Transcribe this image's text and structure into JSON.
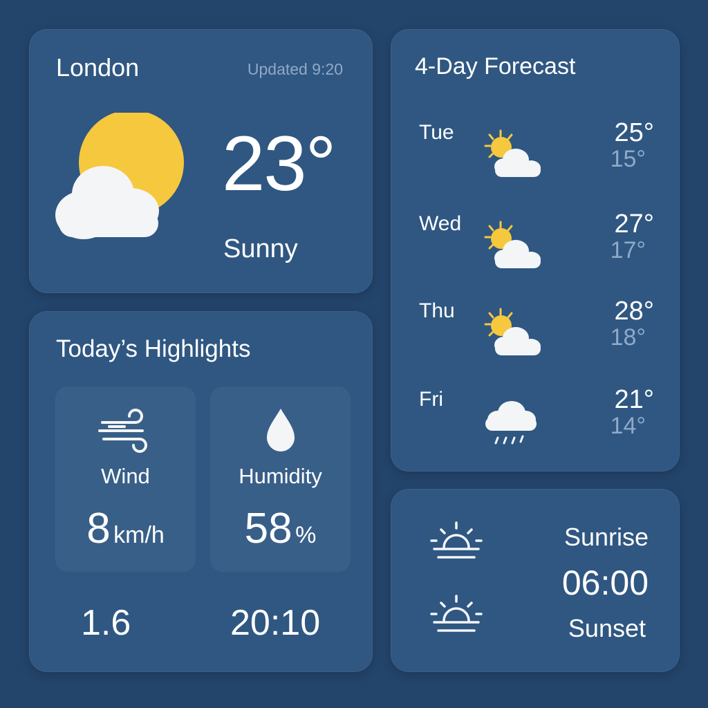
{
  "current": {
    "city": "London",
    "updated": "Updated 9:20",
    "temperature": "23°",
    "condition": "Sunny",
    "icon": "sun-cloud-icon"
  },
  "forecast": {
    "title": "4-Day Forecast",
    "days": [
      {
        "day": "Tue",
        "high": "25°",
        "low": "15°",
        "icon": "partly-sunny-icon"
      },
      {
        "day": "Wed",
        "high": "27°",
        "low": "17°",
        "icon": "partly-sunny-icon"
      },
      {
        "day": "Thu",
        "high": "28°",
        "low": "18°",
        "icon": "partly-sunny-icon"
      },
      {
        "day": "Fri",
        "high": "21°",
        "low": "14°",
        "icon": "rain-cloud-icon"
      }
    ]
  },
  "highlights": {
    "title": "Today’s Highlights",
    "wind": {
      "label": "Wind",
      "value": "8",
      "unit": "km/h",
      "icon": "wind-icon"
    },
    "humidity": {
      "label": "Humidity",
      "value": "58",
      "unit": "%",
      "icon": "droplet-icon"
    },
    "bottom_left": "1.6",
    "bottom_right": "20:10"
  },
  "sun": {
    "sunrise_label": "Sunrise",
    "time": "06:00",
    "sunset_label": "Sunset",
    "sunrise_icon": "sunrise-icon",
    "sunset_icon": "sunset-icon"
  },
  "colors": {
    "background": "#23446b",
    "card": "#2f5781",
    "tile": "#385f88",
    "muted_text": "#8fa9c9",
    "sun_yellow": "#f6c83e"
  }
}
